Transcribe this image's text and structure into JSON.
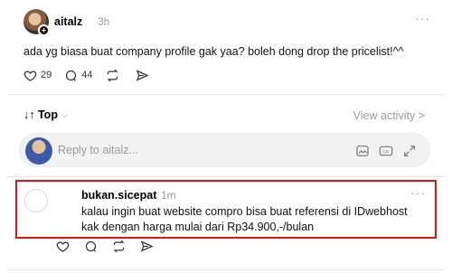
{
  "post": {
    "username": "aitalz",
    "time": "3h",
    "more": "···",
    "text": "ada yg biasa buat company profile gak yaa? boleh dong drop the pricelist!^^",
    "likes": "29",
    "comments": "44",
    "icons": [
      "heart-icon",
      "comment-icon",
      "repost-icon",
      "share-icon"
    ]
  },
  "controls": {
    "sort_label": "↓↑ Top",
    "sort_chevron": "⌵",
    "view_activity": "View activity >"
  },
  "reply": {
    "placeholder": "Reply to aitalz...",
    "icons": [
      "image-icon",
      "gif-icon",
      "expand-icon"
    ]
  },
  "comment": {
    "username": "bukan.sicepat",
    "time": "1m",
    "more": "···",
    "text": "kalau ingin buat website compro bisa buat referensi di IDwebhost kak dengan harga mulai dari Rp34.900,-/bulan",
    "highlight_color": "#e0131a"
  }
}
